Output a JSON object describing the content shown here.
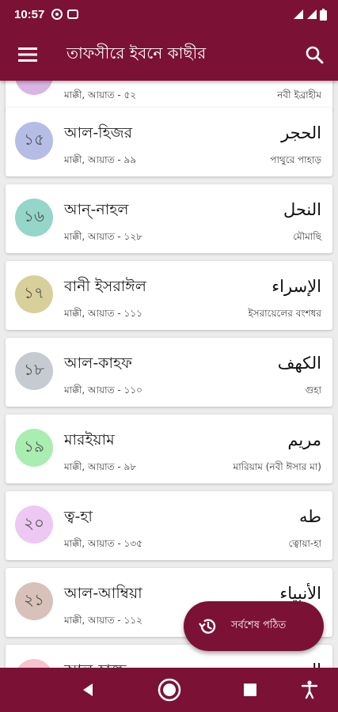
{
  "status_bar": {
    "time": "10:57"
  },
  "app_bar": {
    "title": "তাফসীরে ইবনে কাছীর"
  },
  "colors": {
    "primary": "#7b1235"
  },
  "surahs": [
    {
      "number": "",
      "name": "",
      "meta": "মাক্কী, আয়াত - ৫২",
      "arabic": "",
      "meaning": "নবী ইব্রাহীম",
      "badge_color": "#d9b5e3"
    },
    {
      "number": "১৫",
      "name": "আল-হিজর",
      "meta": "মাক্কী, আয়াত - ৯৯",
      "arabic": "الحجر",
      "meaning": "পাথুরে পাহাড়",
      "badge_color": "#b5bde6"
    },
    {
      "number": "১৬",
      "name": "আন্-নাহল",
      "meta": "মাক্কী, আয়াত - ১২৮",
      "arabic": "النحل",
      "meaning": "মৌমাছি",
      "badge_color": "#94d6c9"
    },
    {
      "number": "১৭",
      "name": "বানী ইসরাঈল",
      "meta": "মাক্কী, আয়াত - ১১১",
      "arabic": "الإسراء",
      "meaning": "ইসরায়েলের বংশধর",
      "badge_color": "#d8d09a"
    },
    {
      "number": "১৮",
      "name": "আল-কাহফ",
      "meta": "মাক্কী, আয়াত - ১১০",
      "arabic": "الكهف",
      "meaning": "গুহা",
      "badge_color": "#c5cbd1"
    },
    {
      "number": "১৯",
      "name": "মারইয়াম",
      "meta": "মাক্কী, আয়াত - ৯৮",
      "arabic": "مريم",
      "meaning": "মারিয়াম (নবী ঈসার মা)",
      "badge_color": "#a9edb1"
    },
    {
      "number": "২০",
      "name": "ত্ব-হা",
      "meta": "মাক্কী, আয়াত - ১৩৫",
      "arabic": "طه",
      "meaning": "ত্বোয়া-হা",
      "badge_color": "#ecc8f2"
    },
    {
      "number": "২১",
      "name": "আল-আম্বিয়া",
      "meta": "মাক্কী, আয়াত - ১১২",
      "arabic": "الأنبياء",
      "meaning": "",
      "badge_color": "#d8c1b9"
    },
    {
      "number": "",
      "name": "আল-হাজ্জ",
      "meta": "",
      "arabic": "الحج",
      "meaning": "",
      "badge_color": "#f5c2cd"
    }
  ],
  "fab": {
    "label": "সর্বশেষ পঠিত"
  }
}
